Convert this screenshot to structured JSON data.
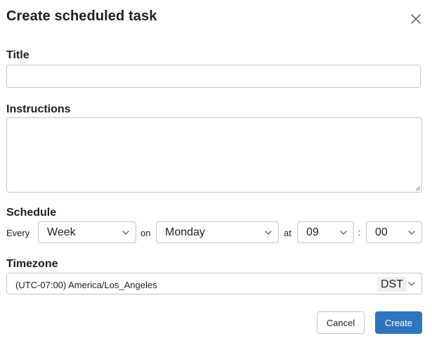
{
  "dialog": {
    "title": "Create scheduled task",
    "close_icon": "close-icon"
  },
  "form": {
    "title": {
      "label": "Title",
      "value": "",
      "placeholder": ""
    },
    "instructions": {
      "label": "Instructions",
      "value": "",
      "placeholder": ""
    },
    "schedule": {
      "label": "Schedule",
      "every_text": "Every",
      "frequency": "Week",
      "on_text": "on",
      "day": "Monday",
      "at_text": "at",
      "hour": "09",
      "separator": ":",
      "minute": "00"
    },
    "timezone": {
      "label": "Timezone",
      "value": "(UTC-07:00) America/Los_Angeles",
      "badge": "DST"
    }
  },
  "actions": {
    "cancel_label": "Cancel",
    "create_label": "Create"
  },
  "colors": {
    "primary": "#2f74c0",
    "border": "#c4c4c4",
    "text": "#1f1f1f"
  }
}
